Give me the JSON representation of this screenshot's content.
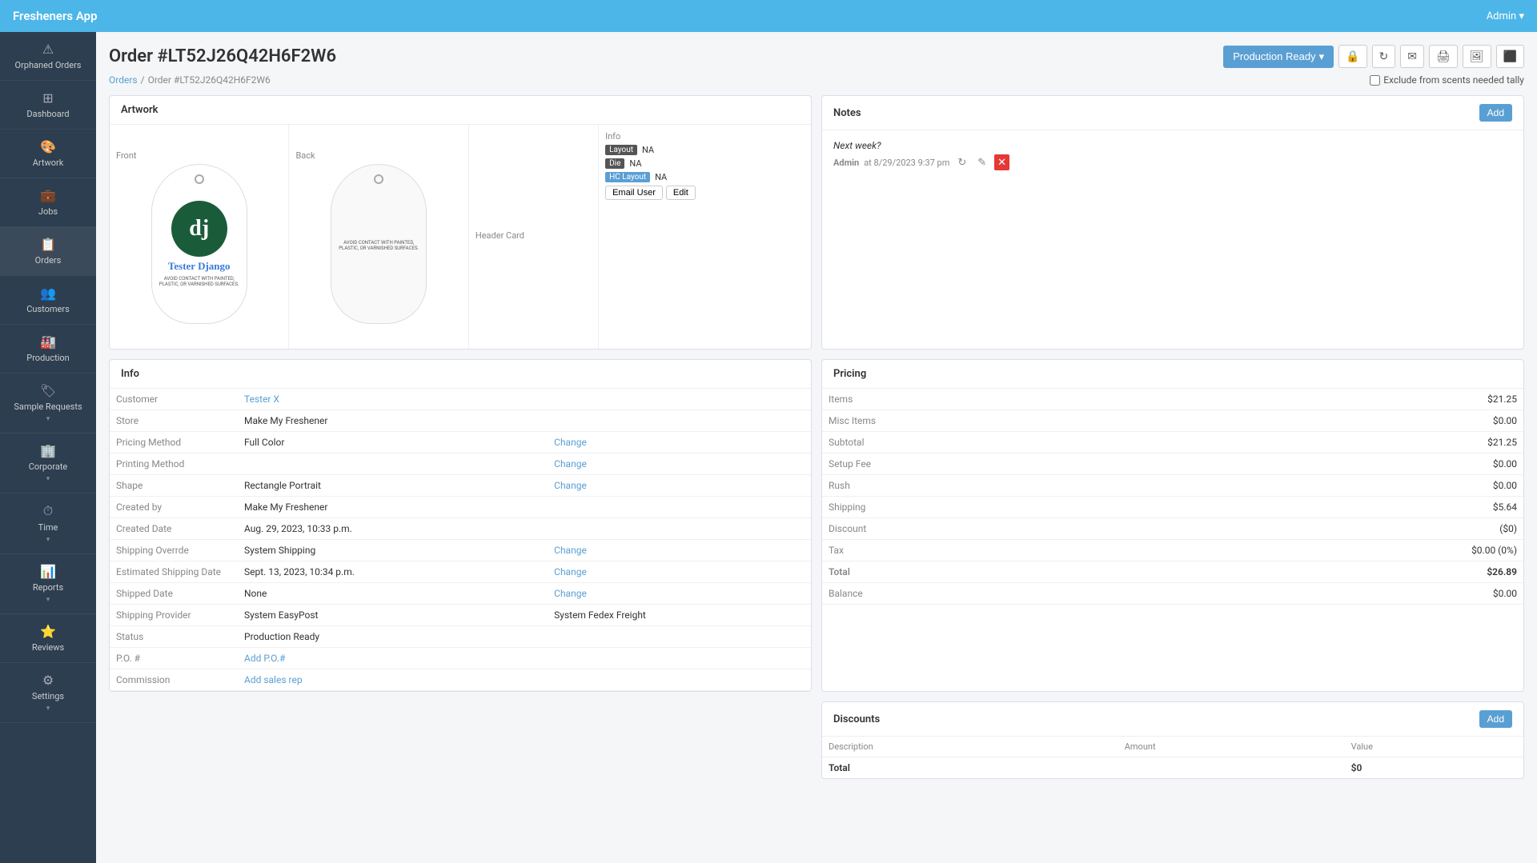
{
  "app": {
    "title": "Fresheners App",
    "admin_label": "Admin ▾"
  },
  "sidebar": {
    "items": [
      {
        "id": "orphaned-orders",
        "label": "Orphaned Orders",
        "icon": "⚠",
        "has_arrow": false
      },
      {
        "id": "dashboard",
        "label": "Dashboard",
        "icon": "⊞",
        "has_arrow": false
      },
      {
        "id": "artwork",
        "label": "Artwork",
        "icon": "🎨",
        "has_arrow": false
      },
      {
        "id": "jobs",
        "label": "Jobs",
        "icon": "💼",
        "has_arrow": false
      },
      {
        "id": "orders",
        "label": "Orders",
        "icon": "📋",
        "has_arrow": false
      },
      {
        "id": "customers",
        "label": "Customers",
        "icon": "👥",
        "has_arrow": false
      },
      {
        "id": "production",
        "label": "Production",
        "icon": "🏭",
        "has_arrow": false
      },
      {
        "id": "sample-requests",
        "label": "Sample Requests",
        "icon": "🏷",
        "has_arrow": true
      },
      {
        "id": "corporate",
        "label": "Corporate",
        "icon": "🏢",
        "has_arrow": true
      },
      {
        "id": "time",
        "label": "Time",
        "icon": "⏱",
        "has_arrow": true
      },
      {
        "id": "reports",
        "label": "Reports",
        "icon": "📊",
        "has_arrow": true
      },
      {
        "id": "reviews",
        "label": "Reviews",
        "icon": "⭐",
        "has_arrow": false
      },
      {
        "id": "settings",
        "label": "Settings",
        "icon": "⚙",
        "has_arrow": true
      }
    ]
  },
  "page": {
    "title": "Order #LT52J26Q42H6F2W6",
    "breadcrumb_orders": "Orders",
    "breadcrumb_current": "Order #LT52J26Q42H6F2W6",
    "exclude_label": "Exclude from scents needed tally",
    "status_button": "Production Ready",
    "status_caret": "▾"
  },
  "artwork": {
    "section_title": "Artwork",
    "tabs": [
      "Front",
      "Back",
      "Header Card",
      "Info"
    ],
    "front_label": "Front",
    "back_label": "Back",
    "header_card_label": "Header Card",
    "info_label": "Info",
    "freshener_name": "Tester Django",
    "warning_text": "AVOID CONTACT WITH PAINTED, PLASTIC, OR VARNISHED SURFACES.",
    "dj_letter": "dj",
    "layout_label": "Layout",
    "layout_value": "NA",
    "die_label": "Die",
    "die_value": "NA",
    "hc_layout_label": "HC Layout",
    "hc_layout_value": "NA",
    "email_user_btn": "Email User",
    "edit_btn": "Edit"
  },
  "info": {
    "section_title": "Info",
    "fields": [
      {
        "label": "Customer",
        "value": "Tester X",
        "is_link": true
      },
      {
        "label": "Store",
        "value": "Make My Freshener",
        "is_link": false
      },
      {
        "label": "Pricing Method",
        "value": "Full Color",
        "has_change": true
      },
      {
        "label": "Printing Method",
        "value": "",
        "has_change": true
      },
      {
        "label": "Shape",
        "value": "Rectangle Portrait",
        "has_change": true
      },
      {
        "label": "Created by",
        "value": "Make My Freshener",
        "is_link": false
      },
      {
        "label": "Created Date",
        "value": "Aug. 29, 2023, 10:33 p.m.",
        "is_link": false
      },
      {
        "label": "Shipping Overrde",
        "value": "System Shipping",
        "has_change": true
      },
      {
        "label": "Estimated Shipping Date",
        "value": "Sept. 13, 2023, 10:34 p.m.",
        "has_change": true
      },
      {
        "label": "Shipped Date",
        "value": "None",
        "has_change": true
      },
      {
        "label": "Shipping Provider",
        "value": "System EasyPost",
        "value2": "System Fedex Freight"
      },
      {
        "label": "Status",
        "value": "Production Ready",
        "is_link": false
      },
      {
        "label": "P.O. #",
        "value": "Add P.O.#",
        "is_link": true
      },
      {
        "label": "Commission",
        "value": "Add sales rep",
        "is_link": true
      }
    ],
    "change_label": "Change"
  },
  "notes": {
    "section_title": "Notes",
    "add_btn": "Add",
    "items": [
      {
        "text": "Next week?",
        "author": "Admin",
        "date": "at 8/29/2023 9:37 pm"
      }
    ]
  },
  "pricing": {
    "section_title": "Pricing",
    "rows": [
      {
        "label": "Items",
        "value": "$21.25"
      },
      {
        "label": "Misc Items",
        "value": "$0.00"
      },
      {
        "label": "Subtotal",
        "value": "$21.25"
      },
      {
        "label": "Setup Fee",
        "value": "$0.00"
      },
      {
        "label": "Rush",
        "value": "$0.00"
      },
      {
        "label": "Shipping",
        "value": "$5.64"
      },
      {
        "label": "Discount",
        "value": "($0)"
      },
      {
        "label": "Tax",
        "value": "$0.00 (0%)"
      },
      {
        "label": "Total",
        "value": "$26.89",
        "is_total": true
      },
      {
        "label": "Balance",
        "value": "$0.00"
      }
    ]
  },
  "discounts": {
    "section_title": "Discounts",
    "add_btn": "Add",
    "columns": [
      "Description",
      "Amount",
      "Value"
    ],
    "rows": [],
    "total_label": "Total",
    "total_value": "$0"
  }
}
